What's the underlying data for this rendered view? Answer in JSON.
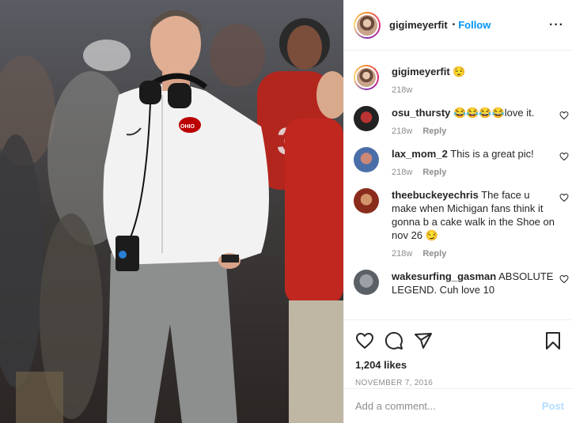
{
  "header": {
    "username": "gigimeyerfit",
    "separator": "•",
    "follow_label": "Follow",
    "more_label": "···"
  },
  "caption": {
    "username": "gigimeyerfit",
    "text": "😌",
    "age": "218w"
  },
  "comments": [
    {
      "username": "osu_thursty",
      "text": "😂😂😂😂love it.",
      "age": "218w",
      "reply_label": "Reply"
    },
    {
      "username": "lax_mom_2",
      "text": "This is a great pic!",
      "age": "218w",
      "reply_label": "Reply"
    },
    {
      "username": "theebuckeyechris",
      "text": "The face u make when Michigan fans think it gonna b a cake walk in the Shoe on nov 26 😏",
      "age": "218w",
      "reply_label": "Reply"
    },
    {
      "username": "wakesurfing_gasman",
      "text": "ABSOLUTE LEGEND. Cuh love 10",
      "age": "",
      "reply_label": ""
    }
  ],
  "post": {
    "likes": "1,204 likes",
    "date": "NOVEMBER 7, 2016"
  },
  "add_comment": {
    "placeholder": "Add a comment...",
    "post_label": "Post"
  },
  "icons": {
    "like": "heart-icon",
    "comment": "comment-bubble-icon",
    "share": "paper-plane-icon",
    "save": "bookmark-icon"
  },
  "colors": {
    "follow": "#0095f6",
    "post_disabled": "#b3dbff",
    "secondary_text": "#8e8e8e",
    "ohio_state_red": "#bb0000"
  }
}
